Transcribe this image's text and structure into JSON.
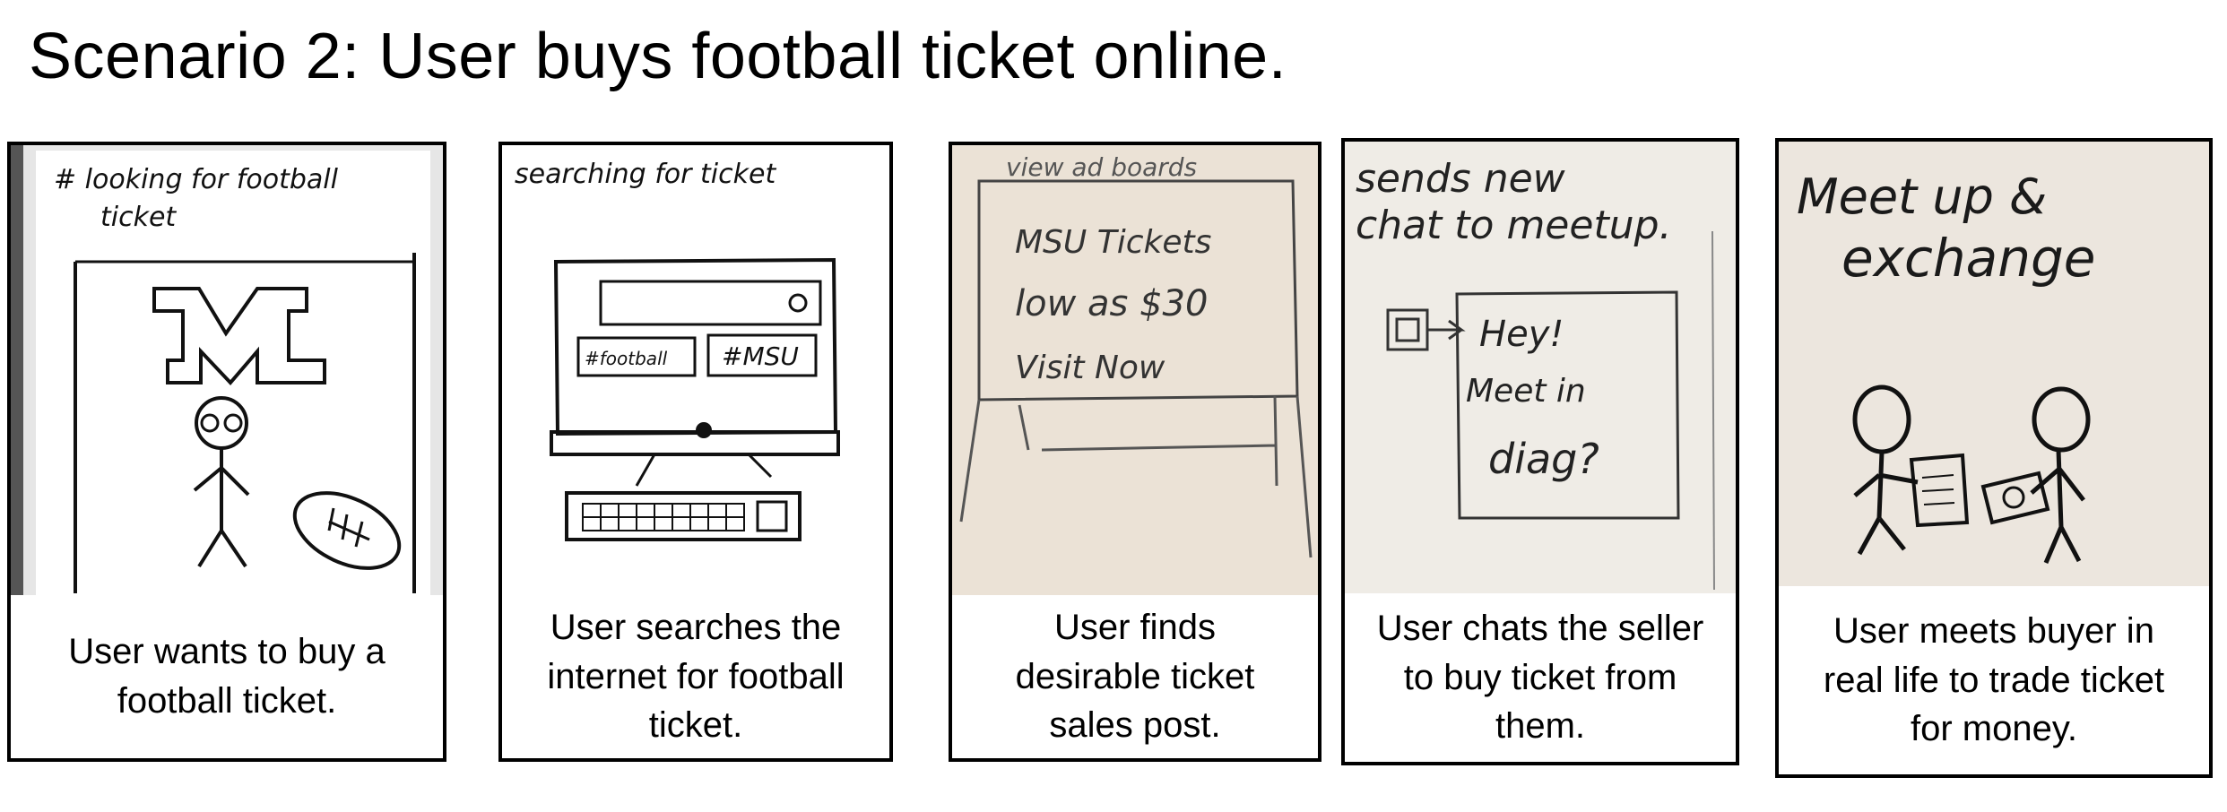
{
  "title": "Scenario 2: User buys football ticket online.",
  "panels": [
    {
      "sketch_text": [
        "# looking for football",
        "ticket",
        "M"
      ],
      "caption": "User wants to buy a\nfootball ticket."
    },
    {
      "sketch_text": [
        "searching   for ticket",
        "#football",
        "#MSU"
      ],
      "caption": "User searches the\ninternet for football\nticket."
    },
    {
      "sketch_text": [
        "view ad boards",
        "MSU Tickets",
        "low as  $30",
        "Visit  Now"
      ],
      "caption": "User finds\ndesirable ticket\nsales post."
    },
    {
      "sketch_text": [
        "sends new",
        "chat to meetup.",
        "Hey!",
        "Meet in",
        "diag?"
      ],
      "caption": "User chats the seller\nto buy ticket from\nthem."
    },
    {
      "sketch_text": [
        "Meet up &",
        "exchange"
      ],
      "caption": "User meets buyer in\nreal life to trade ticket\nfor money."
    }
  ]
}
